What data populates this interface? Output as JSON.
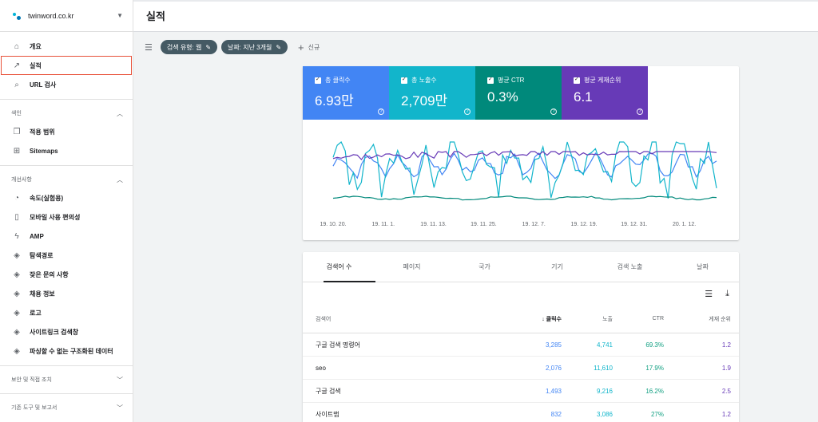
{
  "property": {
    "name": "twinword.co.kr"
  },
  "nav": {
    "overview": "개요",
    "performance": "실적",
    "url_inspection": "URL 검사"
  },
  "sections": {
    "index": "색인",
    "index_items": [
      "적용 범위",
      "Sitemaps"
    ],
    "enhancements": "개선사항",
    "enhancement_items": [
      "속도(실험용)",
      "모바일 사용 편의성",
      "AMP",
      "탐색경로",
      "잦은 문의 사항",
      "채용 정보",
      "로고",
      "사이트링크 검색창",
      "파싱할 수 없는 구조화된 데이터"
    ],
    "security": "보안 및 직접 조치",
    "legacy": "기존 도구 및 보고서"
  },
  "header": {
    "title": "실적"
  },
  "filters": {
    "chips": [
      "검색 유형: 웹",
      "날짜: 지난 3개월"
    ],
    "new_label": "신규"
  },
  "metrics": [
    {
      "label": "총 클릭수",
      "value": "6.93만",
      "color": "#4285f4"
    },
    {
      "label": "총 노출수",
      "value": "2,709만",
      "color": "#12b5cb"
    },
    {
      "label": "평균 CTR",
      "value": "0.3%",
      "color": "#00897b"
    },
    {
      "label": "평균 게재순위",
      "value": "6.1",
      "color": "#673ab7"
    }
  ],
  "chart_data": {
    "type": "line",
    "x": [
      "19. 10. 20.",
      "19. 11. 1.",
      "19. 11. 13.",
      "19. 11. 25.",
      "19. 12. 7.",
      "19. 12. 19.",
      "19. 12. 31.",
      "20. 1. 12."
    ],
    "y_axis": "not labeled",
    "series": [
      {
        "name": "총 클릭수",
        "color": "#4285f4"
      },
      {
        "name": "총 노출수",
        "color": "#12b5cb"
      },
      {
        "name": "평균 CTR",
        "color": "#00897b"
      },
      {
        "name": "평균 게재순위",
        "color": "#673ab7"
      }
    ]
  },
  "tabs": [
    "검색어 수",
    "페이지",
    "국가",
    "기기",
    "검색 노출",
    "날짜"
  ],
  "table": {
    "headers": [
      "검색어",
      "클릭수",
      "노출",
      "CTR",
      "게재 순위"
    ],
    "rows": [
      [
        "구글 검색 명령어",
        "3,285",
        "4,741",
        "69.3%",
        "1.2"
      ],
      [
        "seo",
        "2,076",
        "11,610",
        "17.9%",
        "1.9"
      ],
      [
        "구글 검색",
        "1,493",
        "9,216",
        "16.2%",
        "2.5"
      ],
      [
        "사이트맵",
        "832",
        "3,086",
        "27%",
        "1.2"
      ]
    ]
  }
}
